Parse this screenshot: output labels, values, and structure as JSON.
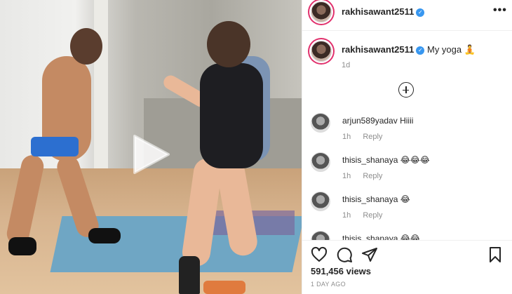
{
  "post": {
    "username": "rakhisawant2511",
    "verified_mark": "✓",
    "more_icon": "•••"
  },
  "caption": {
    "username": "rakhisawant2511",
    "text": "My yoga 🧘",
    "time": "1d"
  },
  "comments": [
    {
      "username": "arjun589yadav",
      "text": "Hiiii",
      "time": "1h",
      "reply_label": "Reply"
    },
    {
      "username": "thisis_shanaya",
      "text": "😂😂😂",
      "time": "1h",
      "reply_label": "Reply"
    },
    {
      "username": "thisis_shanaya",
      "text": "😂",
      "time": "1h",
      "reply_label": "Reply"
    },
    {
      "username": "thisis_shanaya",
      "text": "😂😂",
      "time": "",
      "reply_label": ""
    }
  ],
  "stats": {
    "views": "591,456 views",
    "time_ago": "1 DAY AGO"
  },
  "icons": [
    "play-icon",
    "heart-icon",
    "comment-icon",
    "share-icon",
    "bookmark-icon",
    "add-circle-icon",
    "verified-badge-icon"
  ],
  "colors": {
    "accent": "#3897f0",
    "story_ring": "#e1306c",
    "secondary_text": "#8e8e8e"
  }
}
